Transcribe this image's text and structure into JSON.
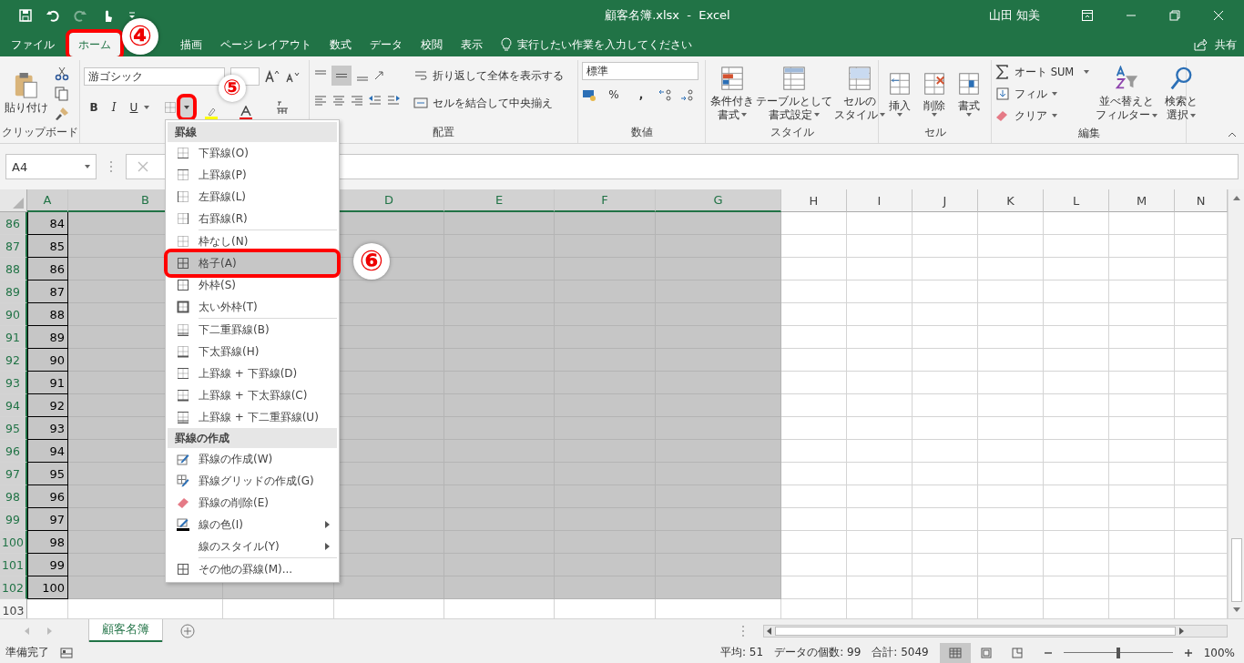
{
  "title_bar": {
    "title": "顧客名簿.xlsx  -  Excel",
    "user": "山田 知美"
  },
  "ribbon_tabs": [
    {
      "kind": "tab",
      "label": "ファイル",
      "selected": false
    },
    {
      "kind": "tab",
      "label": "ホーム",
      "selected": true,
      "annotated": true
    },
    {
      "kind": "covered"
    },
    {
      "kind": "tab",
      "label": "描画",
      "selected": false
    },
    {
      "kind": "tab",
      "label": "ページ レイアウト",
      "selected": false
    },
    {
      "kind": "tab",
      "label": "数式",
      "selected": false
    },
    {
      "kind": "tab",
      "label": "データ",
      "selected": false
    },
    {
      "kind": "tab",
      "label": "校閲",
      "selected": false
    },
    {
      "kind": "tab",
      "label": "表示",
      "selected": false
    }
  ],
  "tell_me": "実行したい作業を入力してください",
  "share": "共有",
  "clipboard": {
    "paste": "貼り付け",
    "label": "クリップボード"
  },
  "font": {
    "name": "游ゴシック",
    "bold": "B",
    "italic": "I",
    "underline": "U",
    "border_dropdown_annotated": true
  },
  "alignment": {
    "wrap": "折り返して全体を表示する",
    "merge": "セルを結合して中央揃え",
    "label": "配置"
  },
  "number": {
    "format": "標準",
    "percent": "%",
    "comma": ",",
    "label": "数値"
  },
  "styles": {
    "buttons": [
      {
        "line1": "条件付き",
        "line2": "書式"
      },
      {
        "line1": "テーブルとして",
        "line2": "書式設定"
      },
      {
        "line1": "セルの",
        "line2": "スタイル"
      }
    ],
    "label": "スタイル"
  },
  "cells": {
    "buttons": [
      "挿入",
      "削除",
      "書式"
    ],
    "label": "セル"
  },
  "editing": {
    "autosum": "オート SUM",
    "fill": "フィル",
    "clear": "クリア",
    "sort": {
      "line1": "並べ替えと",
      "line2": "フィルター"
    },
    "find": {
      "line1": "検索と",
      "line2": "選択"
    },
    "label": "編集"
  },
  "formula_bar": {
    "name_box": "A4"
  },
  "columns": [
    {
      "label": "A",
      "selected": true
    },
    {
      "label": "B",
      "selected": true
    },
    {
      "selected": true
    },
    {
      "label": "D",
      "selected": true
    },
    {
      "label": "E",
      "selected": true
    },
    {
      "label": "F",
      "selected": true
    },
    {
      "label": "G",
      "selected": true
    },
    {
      "label": "H",
      "selected": false
    },
    {
      "label": "I",
      "selected": false
    },
    {
      "label": "J",
      "selected": false
    },
    {
      "label": "K",
      "selected": false
    },
    {
      "label": "L",
      "selected": false
    },
    {
      "label": "M",
      "selected": false
    },
    {
      "label": "N",
      "selected": false
    }
  ],
  "rows": [
    {
      "number": "86",
      "selected": true,
      "cell_a": "84"
    },
    {
      "number": "87",
      "selected": true,
      "cell_a": "85"
    },
    {
      "number": "88",
      "selected": true,
      "cell_a": "86"
    },
    {
      "number": "89",
      "selected": true,
      "cell_a": "87"
    },
    {
      "number": "90",
      "selected": true,
      "cell_a": "88"
    },
    {
      "number": "91",
      "selected": true,
      "cell_a": "89"
    },
    {
      "number": "92",
      "selected": true,
      "cell_a": "90"
    },
    {
      "number": "93",
      "selected": true,
      "cell_a": "91"
    },
    {
      "number": "94",
      "selected": true,
      "cell_a": "92"
    },
    {
      "number": "95",
      "selected": true,
      "cell_a": "93"
    },
    {
      "number": "96",
      "selected": true,
      "cell_a": "94"
    },
    {
      "number": "97",
      "selected": true,
      "cell_a": "95"
    },
    {
      "number": "98",
      "selected": true,
      "cell_a": "96"
    },
    {
      "number": "99",
      "selected": true,
      "cell_a": "97"
    },
    {
      "number": "100",
      "selected": true,
      "cell_a": "98"
    },
    {
      "number": "101",
      "selected": true,
      "cell_a": "99"
    },
    {
      "number": "102",
      "selected": true,
      "cell_a": "100"
    },
    {
      "number": "103",
      "selected": false
    }
  ],
  "border_menu": {
    "items": [
      {
        "kind": "header",
        "label": "罫線"
      },
      {
        "kind": "item",
        "label": "下罫線(O)",
        "selected": false,
        "submenu": false
      },
      {
        "kind": "item",
        "label": "上罫線(P)",
        "selected": false,
        "submenu": false
      },
      {
        "kind": "item",
        "label": "左罫線(L)",
        "selected": false,
        "submenu": false
      },
      {
        "kind": "item",
        "label": "右罫線(R)",
        "selected": false,
        "submenu": false
      },
      {
        "kind": "item",
        "label": "枠なし(N)",
        "selected": false,
        "submenu": false,
        "separator_before": true
      },
      {
        "kind": "item",
        "label": "格子(A)",
        "selected": true,
        "submenu": false,
        "annotated": true
      },
      {
        "kind": "item",
        "label": "外枠(S)",
        "selected": false,
        "submenu": false
      },
      {
        "kind": "item",
        "label": "太い外枠(T)",
        "selected": false,
        "submenu": false
      },
      {
        "kind": "item",
        "label": "下二重罫線(B)",
        "selected": false,
        "submenu": false,
        "separator_before": true
      },
      {
        "kind": "item",
        "label": "下太罫線(H)",
        "selected": false,
        "submenu": false
      },
      {
        "kind": "item",
        "label": "上罫線 + 下罫線(D)",
        "selected": false,
        "submenu": false
      },
      {
        "kind": "item",
        "label": "上罫線 + 下太罫線(C)",
        "selected": false,
        "submenu": false
      },
      {
        "kind": "item",
        "label": "上罫線 + 下二重罫線(U)",
        "selected": false,
        "submenu": false
      },
      {
        "kind": "header",
        "label": "罫線の作成"
      },
      {
        "kind": "item",
        "label": "罫線の作成(W)",
        "selected": false,
        "submenu": false
      },
      {
        "kind": "item",
        "label": "罫線グリッドの作成(G)",
        "selected": false,
        "submenu": false
      },
      {
        "kind": "item",
        "label": "罫線の削除(E)",
        "selected": false,
        "submenu": false
      },
      {
        "kind": "item",
        "label": "線の色(I)",
        "selected": false,
        "submenu": true
      },
      {
        "kind": "item",
        "label": "線のスタイル(Y)",
        "selected": false,
        "submenu": true
      },
      {
        "kind": "item",
        "label": "その他の罫線(M)...",
        "selected": false,
        "submenu": false,
        "separator_before": true
      }
    ]
  },
  "sheet_tabs": [
    {
      "label": "顧客名簿",
      "selected": true
    }
  ],
  "status_bar": {
    "ready": "準備完了",
    "average": "平均: 51",
    "count": "データの個数: 99",
    "sum": "合計: 5049",
    "zoom": "100%",
    "zoom_slider": {
      "level": 0.5
    }
  },
  "callouts": [
    {
      "number": "④"
    },
    {
      "number": "⑤"
    },
    {
      "number": "⑥"
    }
  ]
}
